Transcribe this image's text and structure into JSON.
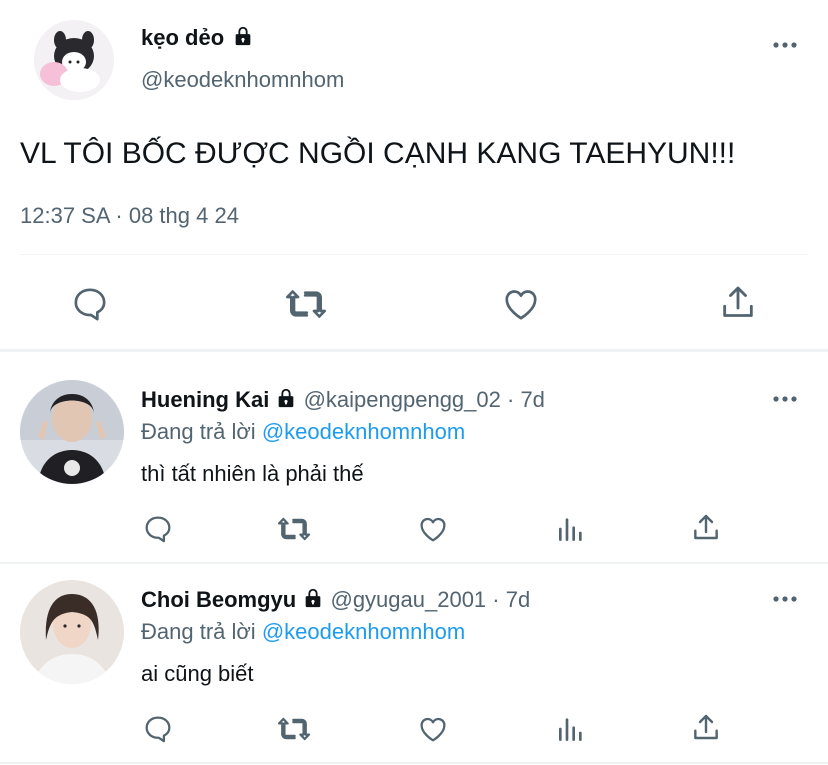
{
  "main_tweet": {
    "display_name": "kẹo dẻo",
    "handle": "@keodeknhomnhom",
    "text": "VL TÔI BỐC ĐƯỢC NGỒI CẠNH KANG TAEHYUN!!!",
    "meta": "12:37 SA · 08 thg 4 24",
    "protected": true
  },
  "replies": [
    {
      "display_name": "Huening Kai",
      "handle": "@kaipengpengg_02",
      "time": "· 7d",
      "reply_prefix": "Đang trả lời",
      "reply_to": "@keodeknhomnhom",
      "text": "thì tất nhiên là phải thế",
      "protected": true
    },
    {
      "display_name": "Choi Beomgyu",
      "handle": "@gyugau_2001",
      "time": "· 7d",
      "reply_prefix": "Đang trả lời",
      "reply_to": "@keodeknhomnhom",
      "text": "ai cũng biết",
      "protected": true
    }
  ],
  "icons": {
    "more": "more-icon",
    "reply": "reply-icon",
    "retweet": "retweet-icon",
    "like": "like-icon",
    "analytics": "analytics-icon",
    "share": "share-icon",
    "lock": "lock-icon"
  },
  "colors": {
    "text": "#0f1419",
    "muted": "#536471",
    "link": "#1d9bf0",
    "divider": "#eff3f4"
  }
}
